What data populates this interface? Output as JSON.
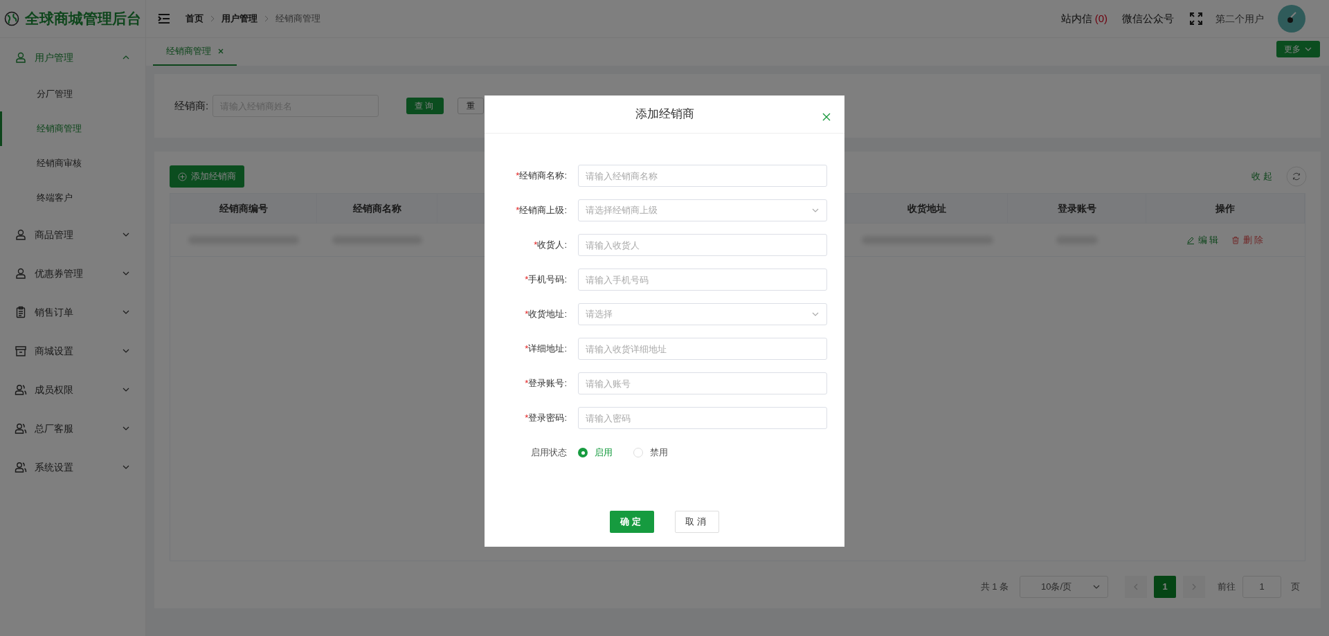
{
  "header": {
    "logo_title": "全球商城管理后台",
    "breadcrumb": [
      {
        "label": "首页",
        "current": false
      },
      {
        "label": "用户管理",
        "current": false
      },
      {
        "label": "经销商管理",
        "current": true
      }
    ],
    "messages_label": "站内信",
    "messages_count": "(0)",
    "wechat_label": "微信公众号",
    "username": "第二个用户"
  },
  "sidebar": {
    "items": [
      {
        "label": "用户管理",
        "kind": "user",
        "expanded": true,
        "children": [
          {
            "label": "分厂管理",
            "selected": false
          },
          {
            "label": "经销商管理",
            "selected": true
          },
          {
            "label": "经销商审核",
            "selected": false
          },
          {
            "label": "终端客户",
            "selected": false
          }
        ]
      },
      {
        "label": "商品管理",
        "kind": "user",
        "expanded": false
      },
      {
        "label": "优惠券管理",
        "kind": "user",
        "expanded": false
      },
      {
        "label": "销售订单",
        "kind": "clipboard",
        "expanded": false
      },
      {
        "label": "商城设置",
        "kind": "store",
        "expanded": false
      },
      {
        "label": "成员权限",
        "kind": "users",
        "expanded": false
      },
      {
        "label": "总厂客服",
        "kind": "users",
        "expanded": false
      },
      {
        "label": "系统设置",
        "kind": "users",
        "expanded": false
      }
    ]
  },
  "tabs": [
    {
      "label": "经销商管理",
      "selected": true
    }
  ],
  "more_button": "更多",
  "search": {
    "label": "经销商:",
    "placeholder": "请输入经销商姓名",
    "query_button": "查询",
    "reset_button": "重"
  },
  "table": {
    "add_button": "添加经销商",
    "collapse_link": "收起",
    "columns": [
      {
        "label": "经销商编号"
      },
      {
        "label": "经销商名称"
      },
      {
        "label": "收货地址"
      },
      {
        "label": "登录账号"
      },
      {
        "label": "操作"
      }
    ],
    "rows": [
      {
        "edit": "编辑",
        "delete": "删除"
      }
    ]
  },
  "pagination": {
    "total": "共 1 条",
    "page_size": "10条/页",
    "pages": [
      {
        "label": "1",
        "selected": true
      }
    ],
    "goto_label": "前往",
    "goto_value": "1",
    "page_suffix": "页"
  },
  "modal": {
    "title": "添加经销商",
    "fields": [
      {
        "kind": "input",
        "required_mark": "*",
        "label": "经销商名称:",
        "placeholder": "请输入经销商名称"
      },
      {
        "kind": "select",
        "required_mark": "*",
        "label": "经销商上级:",
        "placeholder": "请选择经销商上级"
      },
      {
        "kind": "input",
        "required_mark": "*",
        "label": "收货人:",
        "placeholder": "请输入收货人"
      },
      {
        "kind": "input",
        "required_mark": "*",
        "label": "手机号码:",
        "placeholder": "请输入手机号码"
      },
      {
        "kind": "select",
        "required_mark": "*",
        "label": "收货地址:",
        "placeholder": "请选择"
      },
      {
        "kind": "input",
        "required_mark": "*",
        "label": "详细地址:",
        "placeholder": "请输入收货详细地址"
      },
      {
        "kind": "input",
        "required_mark": "*",
        "label": "登录账号:",
        "placeholder": "请输入账号"
      },
      {
        "kind": "input",
        "required_mark": "*",
        "label": "登录密码:",
        "placeholder": "请输入密码"
      }
    ],
    "status": {
      "label": "启用状态",
      "options": [
        {
          "label": "启用",
          "selected": true
        },
        {
          "label": "禁用",
          "selected": false
        }
      ]
    },
    "confirm_button": "确定",
    "cancel_button": "取消"
  }
}
